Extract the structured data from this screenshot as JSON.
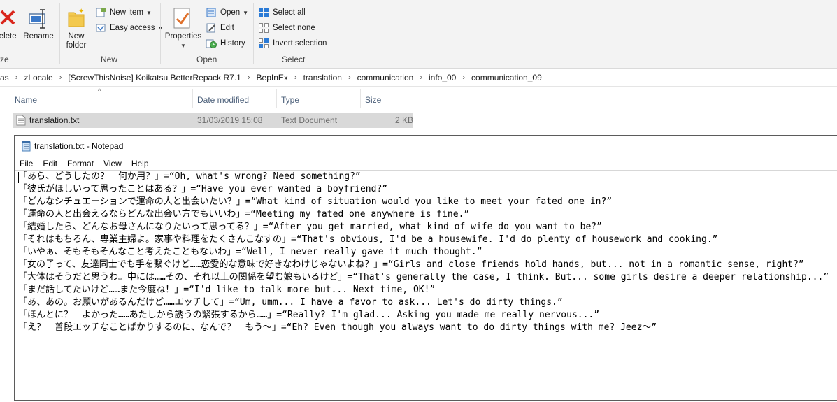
{
  "ribbon": {
    "delete_label": "Delete",
    "rename_label": "Rename",
    "organize_label_fragment": "ze",
    "new_folder_label": "New folder",
    "new_item_label": "New item",
    "easy_access_label": "Easy access",
    "new_group_label": "New",
    "properties_label": "Properties",
    "open_label": "Open",
    "edit_label": "Edit",
    "history_label": "History",
    "open_group_label": "Open",
    "select_all_label": "Select all",
    "select_none_label": "Select none",
    "invert_selection_label": "Invert selection",
    "select_group_label": "Select"
  },
  "address": {
    "crumbs": [
      "as",
      "zLocale",
      "[ScrewThisNoise] Koikatsu BetterRepack R7.1",
      "BepInEx",
      "translation",
      "communication",
      "info_00",
      "communication_09"
    ]
  },
  "file_list": {
    "columns": [
      "Name",
      "Date modified",
      "Type",
      "Size"
    ],
    "files": [
      {
        "name": "translation.txt",
        "date": "31/03/2019 15:08",
        "type": "Text Document",
        "size": "2 KB"
      }
    ]
  },
  "notepad": {
    "title": "translation.txt - Notepad",
    "menu": [
      "File",
      "Edit",
      "Format",
      "View",
      "Help"
    ],
    "lines": [
      "「あら、どうしたの？　何か用？」=“Oh, what's wrong? Need something?”",
      "「彼氏がほしいって思ったことはある？」=“Have you ever wanted a boyfriend?”",
      "「どんなシチュエーションで運命の人と出会いたい？」=“What kind of situation would you like to meet your fated one in?”",
      "「運命の人と出会えるならどんな出会い方でもいいわ」=“Meeting my fated one anywhere is fine.”",
      "「結婚したら、どんなお母さんになりたいって思ってる？」=“After you get married, what kind of wife do you want to be?”",
      "「それはもちろん、専業主婦よ。家事や料理をたくさんこなすの」=“That's obvious, I'd be a housewife. I'd do plenty of housework and cooking.”",
      "「いやぁ、そもそもそんなこと考えたこともないわ」=“Well, I never really gave it much thought.”",
      "「女の子って、友達同士でも手を繋ぐけど……恋愛的な意味で好きなわけじゃないよね？」=“Girls and close friends hold hands, but... not in a romantic sense, right?”",
      "「大体はそうだと思うわ。中には……その、それ以上の関係を望む娘もいるけど」=“That's generally the case, I think. But... some girls desire a deeper relationship...”",
      "「まだ話してたいけど……また今度ね！」=“I'd like to talk more but... Next time, OK!”",
      "「あ、あの。お願いがあるんだけど……エッチして」=“Um, umm... I have a favor to ask... Let's do dirty things.”",
      "「ほんとに？　よかった……あたしから誘うの緊張するから……」=“Really? I'm glad... Asking you made me really nervous...”",
      "「え？　普段エッチなことばかりするのに、なんで？　もう～」=“Eh? Even though you always want to do dirty things with me? Jeez～”"
    ]
  },
  "colors": {
    "ribbon_bg": "#f3f3f3",
    "delete_red": "#d9261c",
    "folder_yellow": "#f3c94e",
    "selection_blue": "#2b7bd6",
    "row_selected": "#d9d9d9"
  }
}
